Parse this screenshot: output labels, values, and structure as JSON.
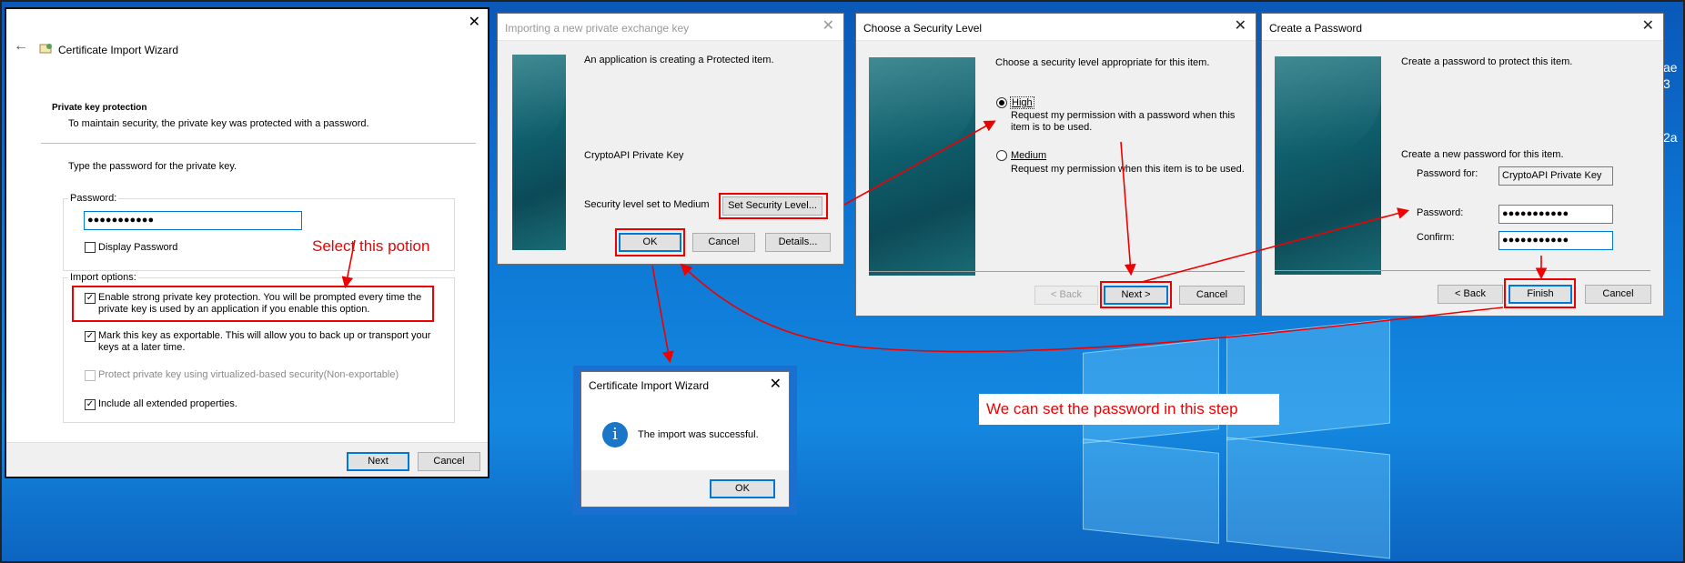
{
  "wizard": {
    "title": "Certificate Import Wizard",
    "close": "✕",
    "back": "←",
    "section_title": "Private key protection",
    "section_desc": "To maintain security, the private key was protected with a password.",
    "prompt": "Type the password for the private key.",
    "password_label": "Password:",
    "password_value": "●●●●●●●●●●●",
    "display_password": "Display Password",
    "import_options_label": "Import options:",
    "options": [
      {
        "label": "Enable strong private key protection. You will be prompted every time the",
        "label2": "private key is used by an application if you enable this option.",
        "checked": true
      },
      {
        "label": "Mark this key as exportable. This will allow you to back up or transport your",
        "label2": "keys at a later time.",
        "checked": true
      },
      {
        "label": "Protect private key using virtualized-based security(Non-exportable)",
        "checked": false,
        "disabled": true
      },
      {
        "label": "Include all extended properties.",
        "checked": true
      }
    ],
    "next": "Next",
    "cancel": "Cancel",
    "annotation": "Select this potion"
  },
  "protected_item": {
    "title": "Importing a new private exchange key",
    "close": "✕",
    "message": "An application is creating a Protected item.",
    "item_name": "CryptoAPI Private Key",
    "security_text": "Security level set to Medium",
    "set_security_button": "Set Security Level...",
    "ok": "OK",
    "cancel": "Cancel",
    "details": "Details..."
  },
  "security_level": {
    "title": "Choose a Security Level",
    "close": "✕",
    "prompt": "Choose a security level appropriate for this item.",
    "high_label": "High",
    "high_desc1": "Request my permission with a password when this",
    "high_desc2": "item is to be used.",
    "medium_label": "Medium",
    "medium_desc": "Request my permission when this item is to be used.",
    "selected": "High",
    "back": "< Back",
    "next": "Next >",
    "cancel": "Cancel"
  },
  "create_password": {
    "title": "Create a Password",
    "close": "✕",
    "prompt": "Create a password to protect this item.",
    "new_password_prompt": "Create a new password for this item.",
    "password_for_label": "Password for:",
    "password_for_value": "CryptoAPI Private Key",
    "password_label": "Password:",
    "password_value": "●●●●●●●●●●●",
    "confirm_label": "Confirm:",
    "confirm_value": "●●●●●●●●●●●",
    "back": "< Back",
    "finish": "Finish",
    "cancel": "Cancel"
  },
  "success": {
    "title": "Certificate Import Wizard",
    "close": "✕",
    "icon_glyph": "i",
    "message": "The import was successful.",
    "ok": "OK"
  },
  "annotation_password": "We can set the password in this step",
  "desktop_edge_text": [
    "ae",
    "3",
    "2a"
  ],
  "colors": {
    "annotation": "#e00000",
    "desktop": "#0e79d6",
    "accent": "#0078d7",
    "info_icon": "#1a76c9"
  }
}
